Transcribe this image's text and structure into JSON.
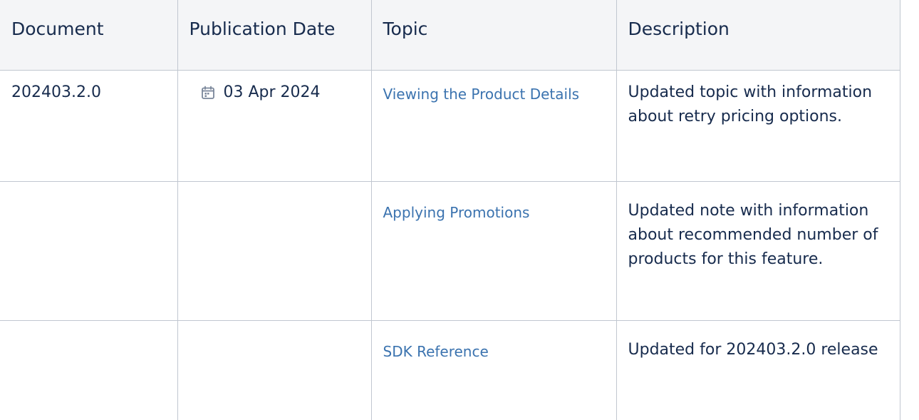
{
  "table": {
    "headers": [
      "Document",
      "Publication Date",
      "Topic",
      "Description"
    ],
    "rows": [
      {
        "document": "202403.2.0",
        "date": "03 Apr 2024",
        "topic": "Viewing the Product Details",
        "description": "Updated topic with information about retry pricing options."
      },
      {
        "document": "",
        "date": "",
        "topic": "Applying Promotions",
        "description": "Updated note with information about recommended number of products for this feature."
      },
      {
        "document": "",
        "date": "",
        "topic": "SDK Reference",
        "description": "Updated for 202403.2.0 release"
      }
    ],
    "icons": {
      "date": "calendar-icon"
    },
    "colors": {
      "link": "#3b73af",
      "header_bg": "#f4f5f7",
      "border": "#c1c7d0",
      "text": "#172b4d"
    }
  }
}
